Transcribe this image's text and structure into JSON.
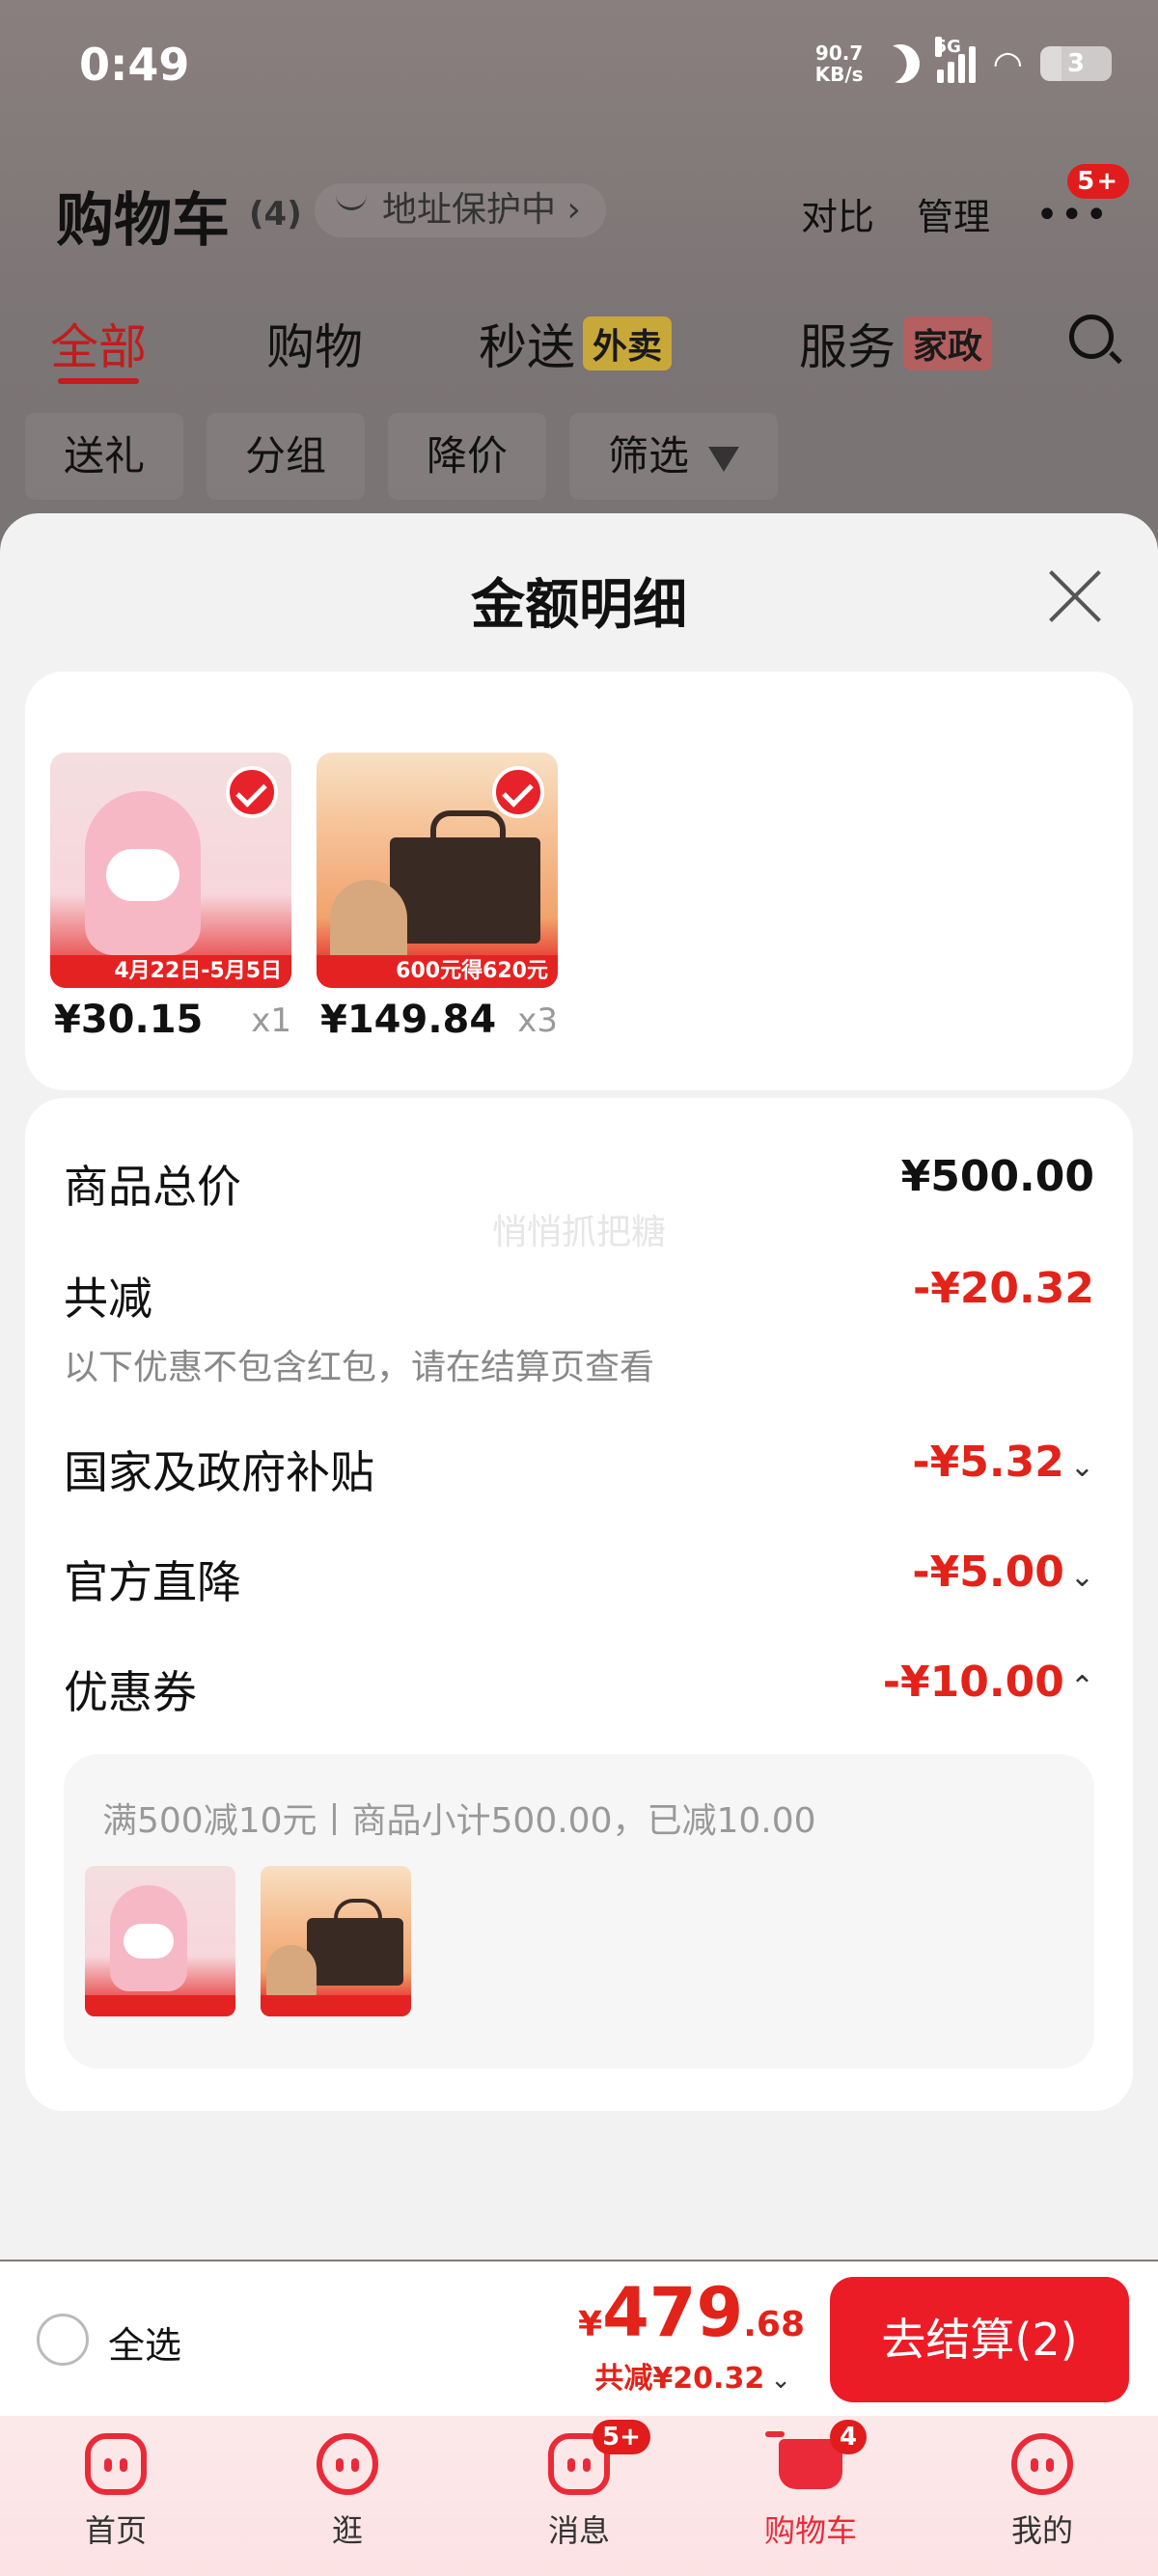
{
  "status": {
    "time": "0:49",
    "net_speed": "90.7",
    "net_unit": "KB/s",
    "network": "5G",
    "battery": "3"
  },
  "cart": {
    "title": "购物车",
    "count": "(4)",
    "address": "地址保护中 ›",
    "compare": "对比",
    "manage": "管理",
    "more_badge": "5+"
  },
  "tabs": [
    {
      "label": "全部"
    },
    {
      "label": "购物"
    },
    {
      "label": "秒送",
      "tag": "外卖"
    },
    {
      "label": "服务",
      "tag": "家政"
    }
  ],
  "chips": [
    "送礼",
    "分组",
    "降价",
    "筛选"
  ],
  "sheet": {
    "title": "金额明细",
    "items": [
      {
        "price": "¥30.15",
        "qty": "x1",
        "banner": "4月22日-5月5日"
      },
      {
        "price": "¥149.84",
        "qty": "x3",
        "banner": "600元得620元"
      }
    ],
    "watermark": "悄悄抓把糖",
    "total_label": "商品总价",
    "total_value": "¥500.00",
    "reduce_label": "共减",
    "reduce_value": "-¥20.32",
    "note": "以下优惠不包含红包，请在结算页查看",
    "subsidy_label": "国家及政府补贴",
    "subsidy_value": "-¥5.32",
    "direct_label": "官方直降",
    "direct_value": "-¥5.00",
    "coupon_label": "优惠券",
    "coupon_value": "-¥10.00",
    "coupon_detail": "满500减10元丨商品小计500.00，已减10.00"
  },
  "checkout": {
    "select_all": "全选",
    "currency": "¥",
    "total_int": "479",
    "total_dec": ".68",
    "saved": "共减¥20.32",
    "button": "去结算(2)"
  },
  "nav": [
    {
      "label": "首页"
    },
    {
      "label": "逛"
    },
    {
      "label": "消息",
      "badge": "5+"
    },
    {
      "label": "购物车",
      "badge": "4"
    },
    {
      "label": "我的"
    }
  ],
  "colors": {
    "accent": "#e2231a",
    "button": "#ec1c27",
    "nav_active": "#ea2a38"
  }
}
